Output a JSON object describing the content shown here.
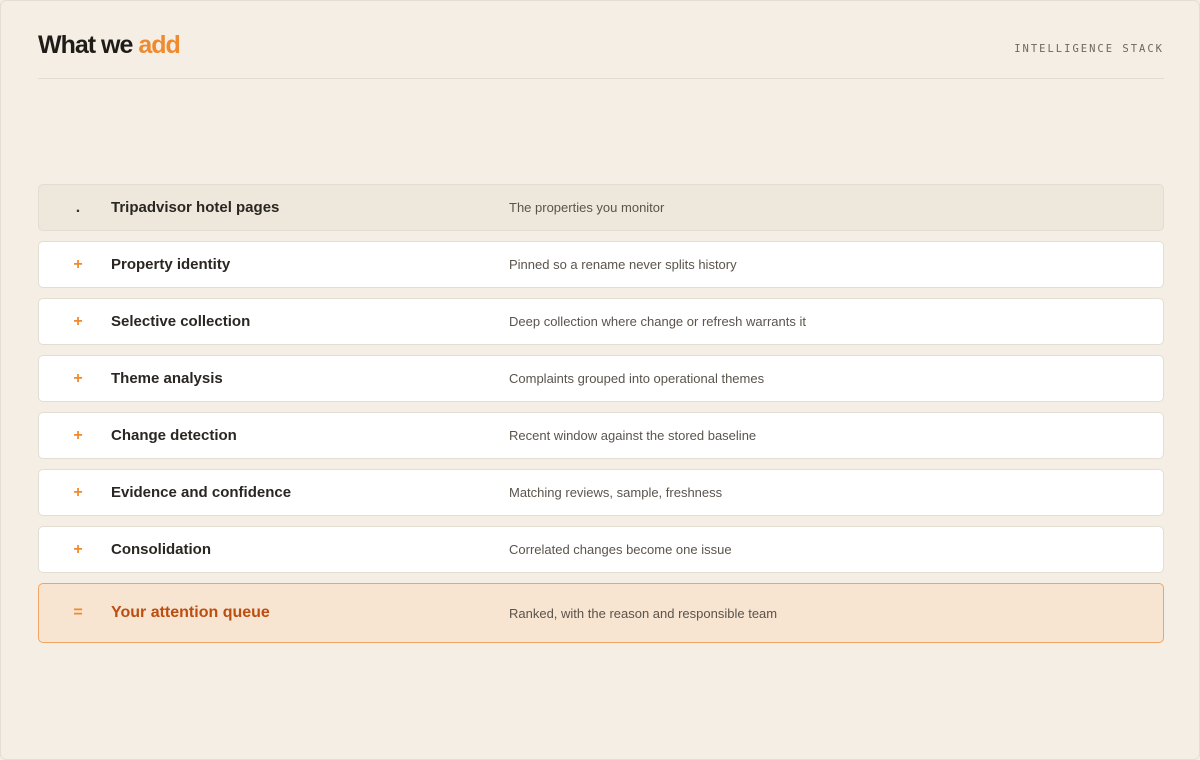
{
  "header": {
    "title_main": "What we ",
    "title_accent": "add",
    "kicker": "INTELLIGENCE STACK"
  },
  "colors": {
    "accent": "#ef8a2f",
    "background": "#f4eee5",
    "final_bg": "#f7e4d1",
    "final_text": "#bc4e10"
  },
  "rows": [
    {
      "symbol": ".",
      "name": "Tripadvisor hotel pages",
      "desc": "The properties you monitor"
    },
    {
      "symbol": "+",
      "name": "Property identity",
      "desc": "Pinned so a rename never splits history"
    },
    {
      "symbol": "+",
      "name": "Selective collection",
      "desc": "Deep collection where change or refresh warrants it"
    },
    {
      "symbol": "+",
      "name": "Theme analysis",
      "desc": "Complaints grouped into operational themes"
    },
    {
      "symbol": "+",
      "name": "Change detection",
      "desc": "Recent window against the stored baseline"
    },
    {
      "symbol": "+",
      "name": "Evidence and confidence",
      "desc": "Matching reviews, sample, freshness"
    },
    {
      "symbol": "+",
      "name": "Consolidation",
      "desc": "Correlated changes become one issue"
    },
    {
      "symbol": "=",
      "name": "Your attention queue",
      "desc": "Ranked, with the reason and responsible team"
    }
  ]
}
